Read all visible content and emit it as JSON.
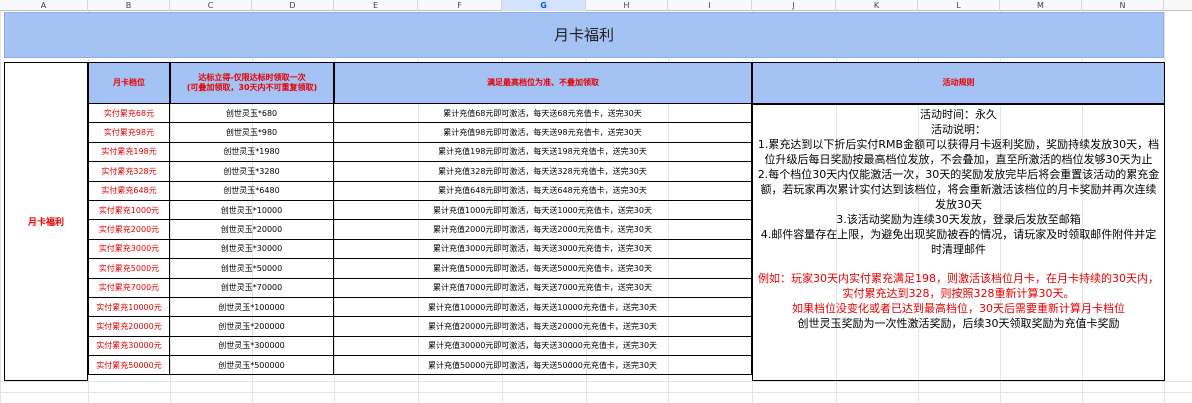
{
  "columns": [
    "A",
    "B",
    "C",
    "D",
    "E",
    "F",
    "G",
    "H",
    "I",
    "J",
    "K",
    "L",
    "M",
    "N"
  ],
  "selected_column": "G",
  "sheet": {
    "title": "月卡福利",
    "left_label": "月卡福利",
    "headers": {
      "tier": "月卡档位",
      "reward_line1": "达标立得-仅限达标时领取一次",
      "reward_line2": "(可叠加领取，30天内不可重复领取)",
      "desc": "满足最高档位为准、不叠加领取",
      "rules": "活动规则"
    },
    "rows": [
      {
        "tier": "实付累充68元",
        "reward": "创世灵玉*680",
        "desc": "累计充值68元即可激活，每天送68元充值卡，送完30天"
      },
      {
        "tier": "实付累充98元",
        "reward": "创世灵玉*980",
        "desc": "累计充值98元即可激活，每天送98元充值卡，送完30天"
      },
      {
        "tier": "实付累充198元",
        "reward": "创世灵玉*1980",
        "desc": "累计充值198元即可激活，每天送198元充值卡，送完30天"
      },
      {
        "tier": "实付累充328元",
        "reward": "创世灵玉*3280",
        "desc": "累计充值328元即可激活，每天送328元充值卡，送完30天"
      },
      {
        "tier": "实付累充648元",
        "reward": "创世灵玉*6480",
        "desc": "累计充值648元即可激活，每天送648元充值卡，送完30天"
      },
      {
        "tier": "实付累充1000元",
        "reward": "创世灵玉*10000",
        "desc": "累计充值1000元即可激活，每天送1000元充值卡，送完30天"
      },
      {
        "tier": "实付累充2000元",
        "reward": "创世灵玉*20000",
        "desc": "累计充值2000元即可激活，每天送2000元充值卡，送完30天"
      },
      {
        "tier": "实付累充3000元",
        "reward": "创世灵玉*30000",
        "desc": "累计充值3000元即可激活，每天送3000元充值卡，送完30天"
      },
      {
        "tier": "实付累充5000元",
        "reward": "创世灵玉*50000",
        "desc": "累计充值5000元即可激活，每天送5000元充值卡，送完30天"
      },
      {
        "tier": "实付累充7000元",
        "reward": "创世灵玉*70000",
        "desc": "累计充值7000元即可激活，每天送7000元充值卡，送完30天"
      },
      {
        "tier": "实付累充10000元",
        "reward": "创世灵玉*100000",
        "desc": "累计充值10000元即可激活，每天送10000元充值卡，送完30天"
      },
      {
        "tier": "实付累充20000元",
        "reward": "创世灵玉*200000",
        "desc": "累计充值20000元即可激活，每天送20000元充值卡，送完30天"
      },
      {
        "tier": "实付累充30000元",
        "reward": "创世灵玉*300000",
        "desc": "累计充值30000元即可激活，每天送30000元充值卡，送完30天"
      },
      {
        "tier": "实付累充50000元",
        "reward": "创世灵玉*500000",
        "desc": "累计充值50000元即可激活，每天送50000元充值卡，送完30天"
      }
    ],
    "rules": {
      "time": "活动时间：永久",
      "intro": "活动说明：",
      "items": [
        "1.累充达到以下折后实付RMB金额可以获得月卡返利奖励，奖励持续发放30天，档位升级后每日奖励按最高档位发放，不会叠加，直至所激活的档位发够30天为止",
        "2.每个档位30天内仅能激活一次，30天的奖励发放完毕后将会重置该活动的累充金额，若玩家再次累计实付达到该档位，将会重新激活该档位的月卡奖励并再次连续发放30天",
        "3.该活动奖励为连续30天发放，登录后发放至邮箱",
        "4.邮件容量存在上限，为避免出现奖励被吞的情况，请玩家及时领取邮件附件并定时清理邮件"
      ],
      "example": "例如：玩家30天内实付累充满足198，则激活该档位月卡，在月卡持续的30天内，实付累充达到328，则按照328重新计算30天。",
      "note": "如果档位没变化或者已达到最高档位，30天后需要重新计算月卡档位",
      "footer": "创世灵玉奖励为一次性激活奖励，后续30天领取奖励为充值卡奖励"
    }
  }
}
